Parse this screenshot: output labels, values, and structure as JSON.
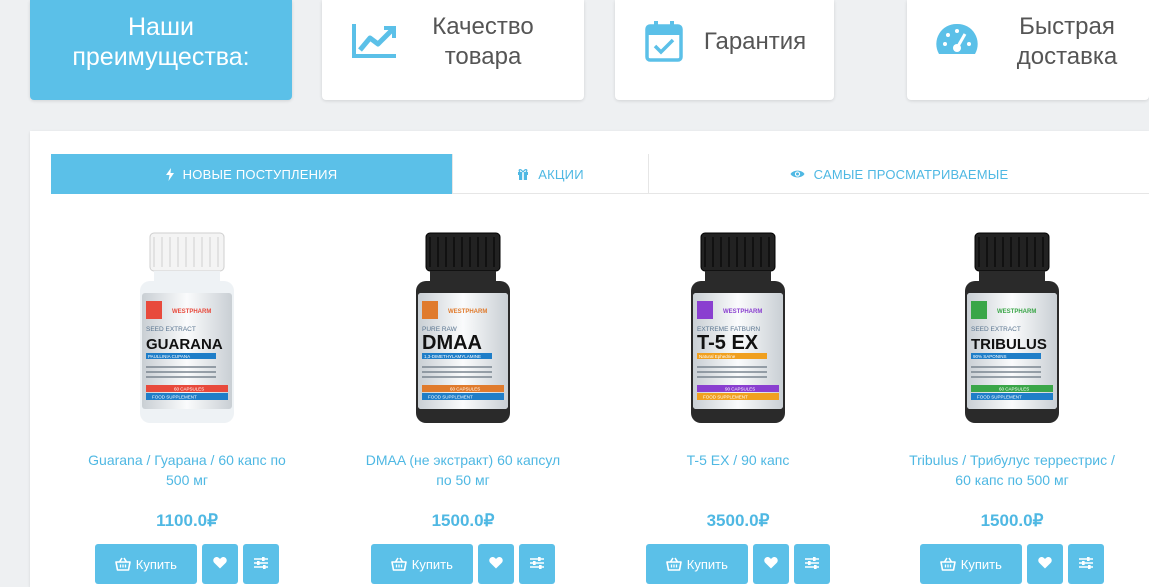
{
  "advantages": {
    "title": "Наши преимущества:",
    "items": [
      {
        "label": "Качество товара",
        "icon": "chart-line-icon"
      },
      {
        "label": "Гарантия",
        "icon": "calendar-check-icon"
      },
      {
        "label": "Быстрая доставка",
        "icon": "speedometer-icon"
      }
    ]
  },
  "colors": {
    "accent": "#5bc0e8",
    "link": "#4fb8e3"
  },
  "tabs": [
    {
      "label": "НОВЫЕ ПОСТУПЛЕНИЯ",
      "icon": "bolt-icon",
      "active": true
    },
    {
      "label": "АКЦИИ",
      "icon": "gift-icon",
      "active": false
    },
    {
      "label": "САМЫЕ ПРОСМАТРИВАЕМЫЕ",
      "icon": "eye-icon",
      "active": false
    }
  ],
  "products": [
    {
      "name": "Guarana / Гуарана / 60 капс по 500 мг",
      "price": "1100.0₽",
      "buy_label": "Купить",
      "image": {
        "brand": "WESTPHARM",
        "line": "ORGANIC LINE",
        "type": "SEED EXTRACT",
        "title": "GUARANA",
        "sub": "PAULLINIA CUPANA",
        "caps": "60 CAPSULES",
        "foot": "FOOD SUPPLEMENT"
      }
    },
    {
      "name": "DMAA (не экстракт) 60 капсул по 50 мг",
      "price": "1500.0₽",
      "buy_label": "Купить",
      "image": {
        "brand": "WESTPHARM",
        "line": "MEDICAL GRADE",
        "type": "PURE RAW",
        "title": "DMAA",
        "sub": "1,3-DIMETHYLAMYLAMINE",
        "caps": "60 CAPSULES",
        "foot": "FOOD SUPPLEMENT"
      }
    },
    {
      "name": "T-5 EX / 90 капс",
      "price": "3500.0₽",
      "buy_label": "Купить",
      "image": {
        "brand": "WESTPHARM",
        "line": "MEDICAL GRADE",
        "type": "EXTREME FATBURN",
        "title": "T-5 EX",
        "sub": "Natural Ephedrine",
        "caps": "90 CAPSULES",
        "foot": "FOOD SUPPLEMENT"
      }
    },
    {
      "name": "Tribulus / Трибулус террестрис / 60 капс по 500 мг",
      "price": "1500.0₽",
      "buy_label": "Купить",
      "image": {
        "brand": "WESTPHARM",
        "line": "ORGANIC LINE",
        "type": "SEED EXTRACT",
        "title": "TRIBULUS",
        "sub": "90% SAPONINS",
        "caps": "60 CAPSULES",
        "foot": "FOOD SUPPLEMENT"
      }
    }
  ]
}
